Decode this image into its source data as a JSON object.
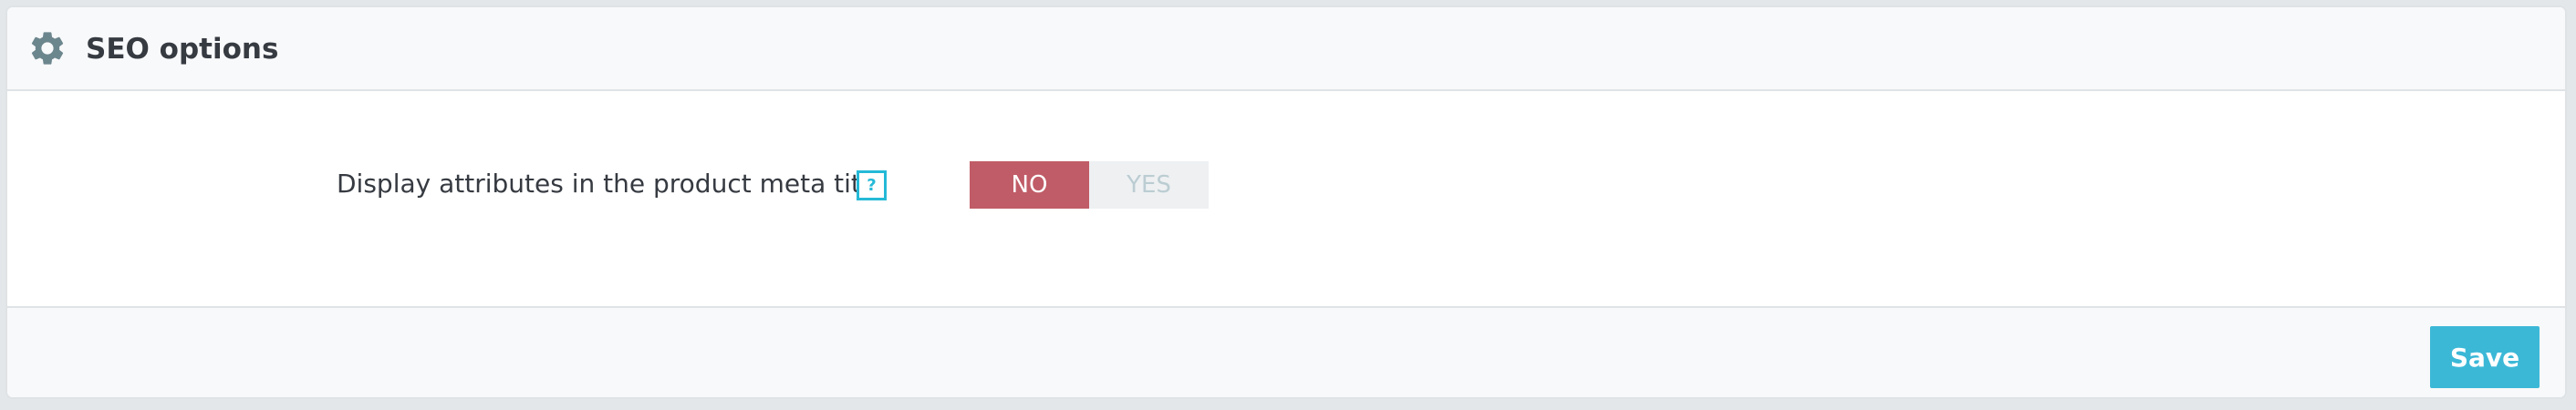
{
  "panel": {
    "title": "SEO options",
    "icon": "gear-icon"
  },
  "form": {
    "label": "Display attributes in the product meta title",
    "help_icon_text": "?",
    "switch": {
      "options": [
        "NO",
        "YES"
      ],
      "selected": "NO"
    }
  },
  "footer": {
    "save_label": "Save"
  },
  "colors": {
    "accent": "#25b9d7",
    "switch_no_active": "#c05c67",
    "save_button": "#3cb8d7"
  }
}
